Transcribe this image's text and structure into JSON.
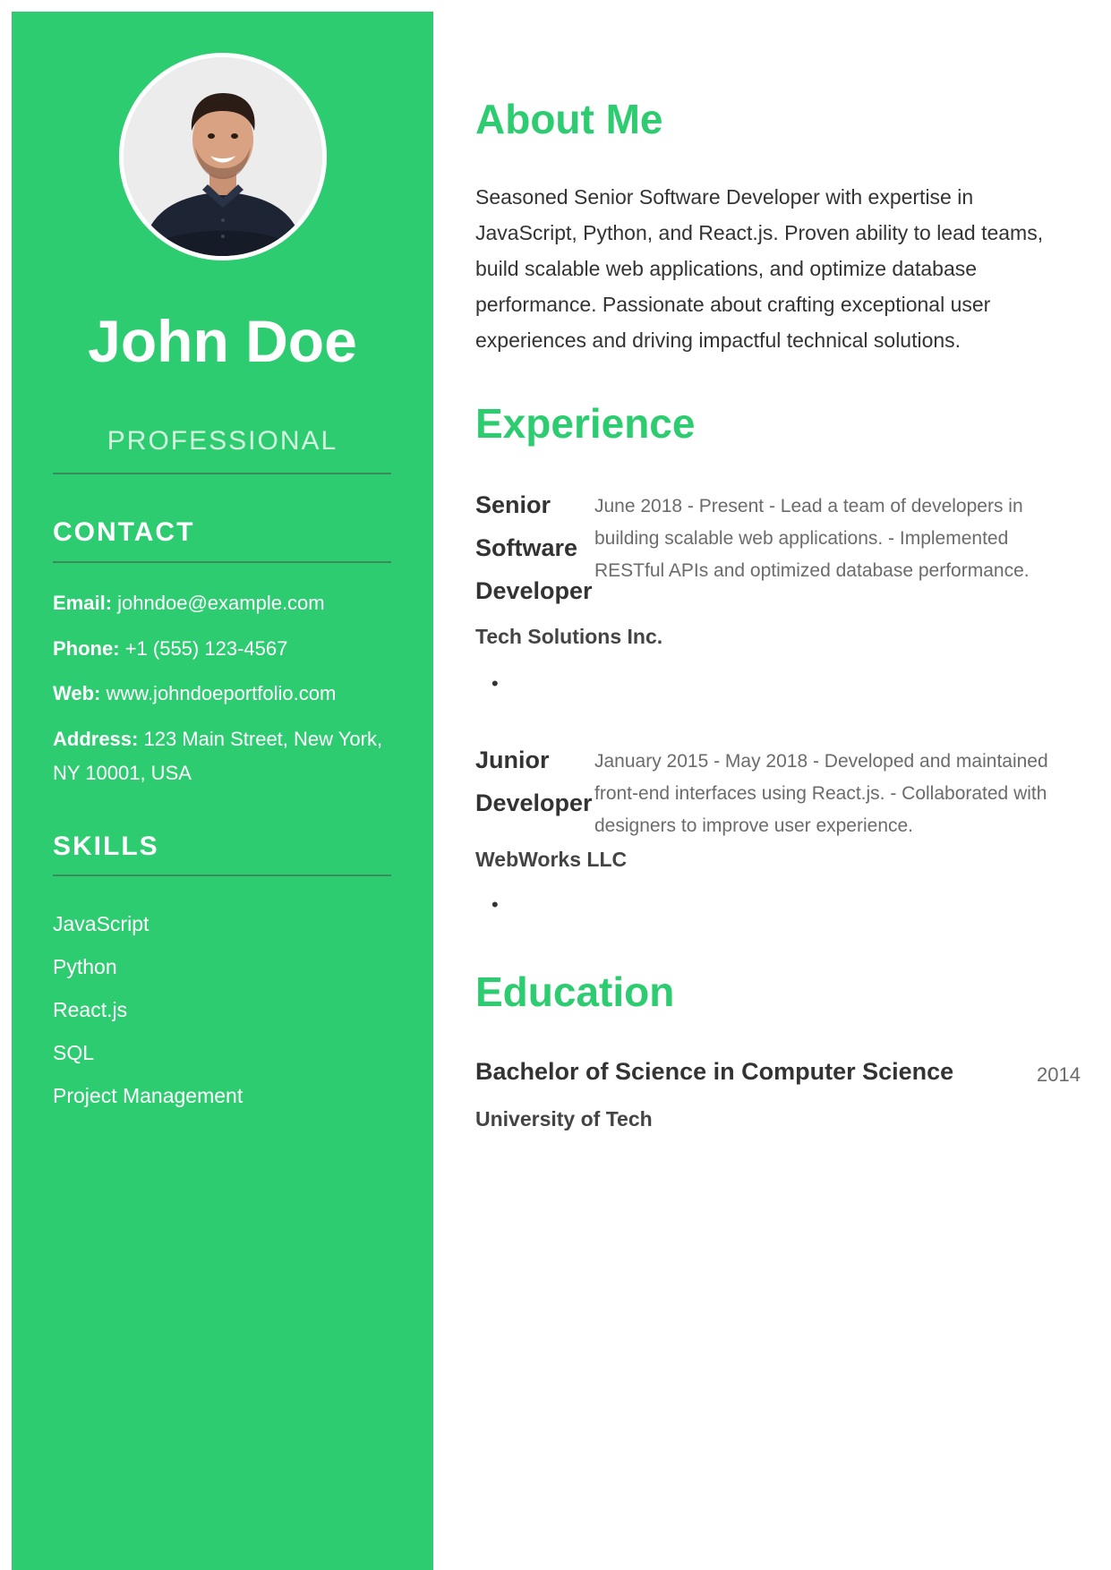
{
  "profile": {
    "name": "John Doe",
    "title": "PROFESSIONAL"
  },
  "contact": {
    "heading": "CONTACT",
    "items": [
      {
        "label": "Email:",
        "value": "johndoe@example.com"
      },
      {
        "label": "Phone:",
        "value": "+1 (555) 123-4567"
      },
      {
        "label": "Web:",
        "value": "www.johndoeportfolio.com"
      },
      {
        "label": "Address:",
        "value": "123 Main Street, New York, NY 10001, USA"
      }
    ]
  },
  "skills": {
    "heading": "SKILLS",
    "items": [
      "JavaScript",
      "Python",
      "React.js",
      "SQL",
      "Project Management"
    ]
  },
  "about": {
    "heading": "About Me",
    "text": "Seasoned Senior Software Developer with expertise in JavaScript, Python, and React.js. Proven ability to lead teams, build scalable web applications, and optimize database performance. Passionate about crafting exceptional user experiences and driving impactful technical solutions."
  },
  "experience": {
    "heading": "Experience",
    "jobs": [
      {
        "role": "Senior Software Developer",
        "description": "June 2018 - Present - Lead a team of developers in building scalable web applications. - Implemented RESTful APIs and optimized database performance.",
        "company": "Tech Solutions Inc.",
        "bullet": "•"
      },
      {
        "role": "Junior Developer",
        "description": "January 2015 - May 2018 - Developed and maintained front-end interfaces using React.js. - Collaborated with designers to improve user experience.",
        "company": "WebWorks LLC",
        "bullet": "•"
      }
    ]
  },
  "education": {
    "heading": "Education",
    "degree": "Bachelor of Science in Computer Science",
    "year": "2014",
    "school": "University of Tech"
  },
  "colors": {
    "accent": "#2ecc71",
    "sidebar_text": "#ffffff",
    "body_text": "#333333",
    "muted_text": "#6b6b6b"
  }
}
